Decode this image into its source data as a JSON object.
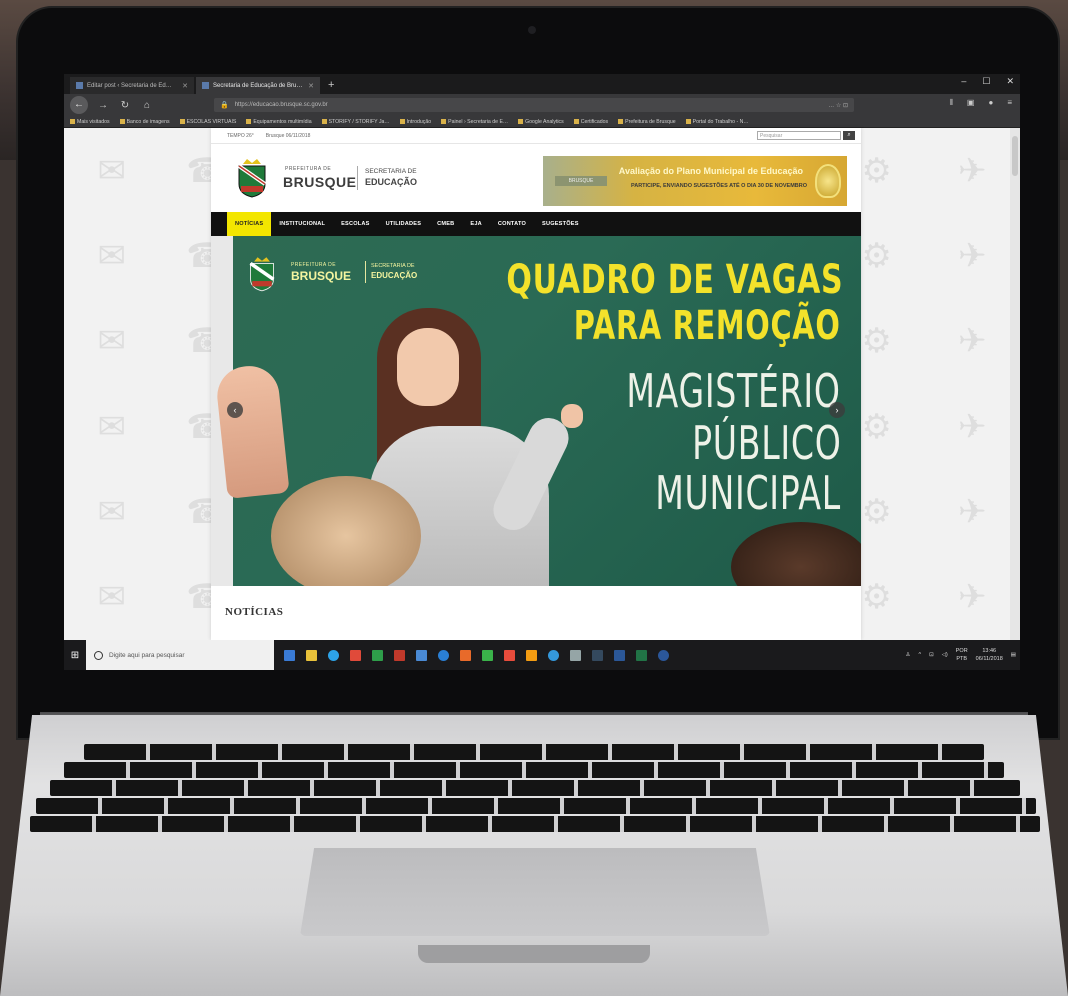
{
  "browser": {
    "tabs": [
      {
        "label": "Editar post ‹ Secretaria de Ed…",
        "active": false
      },
      {
        "label": "Secretaria de Educação de Bru…",
        "active": true
      }
    ],
    "new_tab": "+",
    "url": "https://educacao.brusque.sc.gov.br",
    "url_right": "…  ☆  ⊡",
    "bookmarks": [
      "Mais visitados",
      "Banco de imagens",
      "ESCOLAS VIRTUAIS",
      "Equipamentos multimídia",
      "STORIFY / STORIFY Ja…",
      "Introdução",
      "Painel › Secretaria de E…",
      "Google Analytics",
      "Certificados",
      "Prefeitura de Brusque",
      "Portal do Trabalho - N…"
    ]
  },
  "site": {
    "top_strip": {
      "weather": "TEMPO  26°",
      "date": "Brusque  06/11/2018",
      "search_placeholder": "Pesquisar"
    },
    "brand": {
      "pref": "PREFEITURA DE",
      "city": "BRUSQUE",
      "sec": "SECRETARIA DE",
      "edu": "EDUCAÇÃO"
    },
    "banner": {
      "logo": "BRUSQUE",
      "line1": "Avaliação do Plano Municipal de Educação",
      "line2": "PARTICIPE, ENVIANDO SUGESTÕES ATÉ O DIA 30 DE NOVEMBRO"
    },
    "menu": [
      "NOTÍCIAS",
      "INSTITUCIONAL",
      "ESCOLAS",
      "UTILIDADES",
      "CMEB",
      "EJA",
      "CONTATO",
      "SUGESTÕES"
    ],
    "hero": {
      "pref": "PREFEITURA DE",
      "city": "BRUSQUE",
      "sec": "SECRETARIA DE",
      "edu": "EDUCAÇÃO",
      "line1": "QUADRO DE VAGAS",
      "line2": "PARA REMOÇÃO",
      "line3": "MAGISTÉRIO",
      "line4": "PÚBLICO",
      "line5": "MUNICIPAL",
      "prev": "‹",
      "next": "›"
    },
    "section_title": "NOTÍCIAS"
  },
  "taskbar": {
    "search_placeholder": "Digite aqui para pesquisar",
    "time": "13:46",
    "date": "06/11/2018",
    "lang": "POR",
    "lang2": "PTB",
    "icon_colors": [
      "#3a7bd5",
      "#e8c13a",
      "#2da3e8",
      "#e04a3a",
      "#2e9e4a",
      "#c0392b",
      "#4a8ad4",
      "#2a7fd4",
      "#e86a2a",
      "#3ab34a",
      "#e74c3c",
      "#f39c12",
      "#3498db",
      "#95a5a6",
      "#34495e",
      "#2b5797",
      "#217346",
      "#2b579a"
    ]
  }
}
